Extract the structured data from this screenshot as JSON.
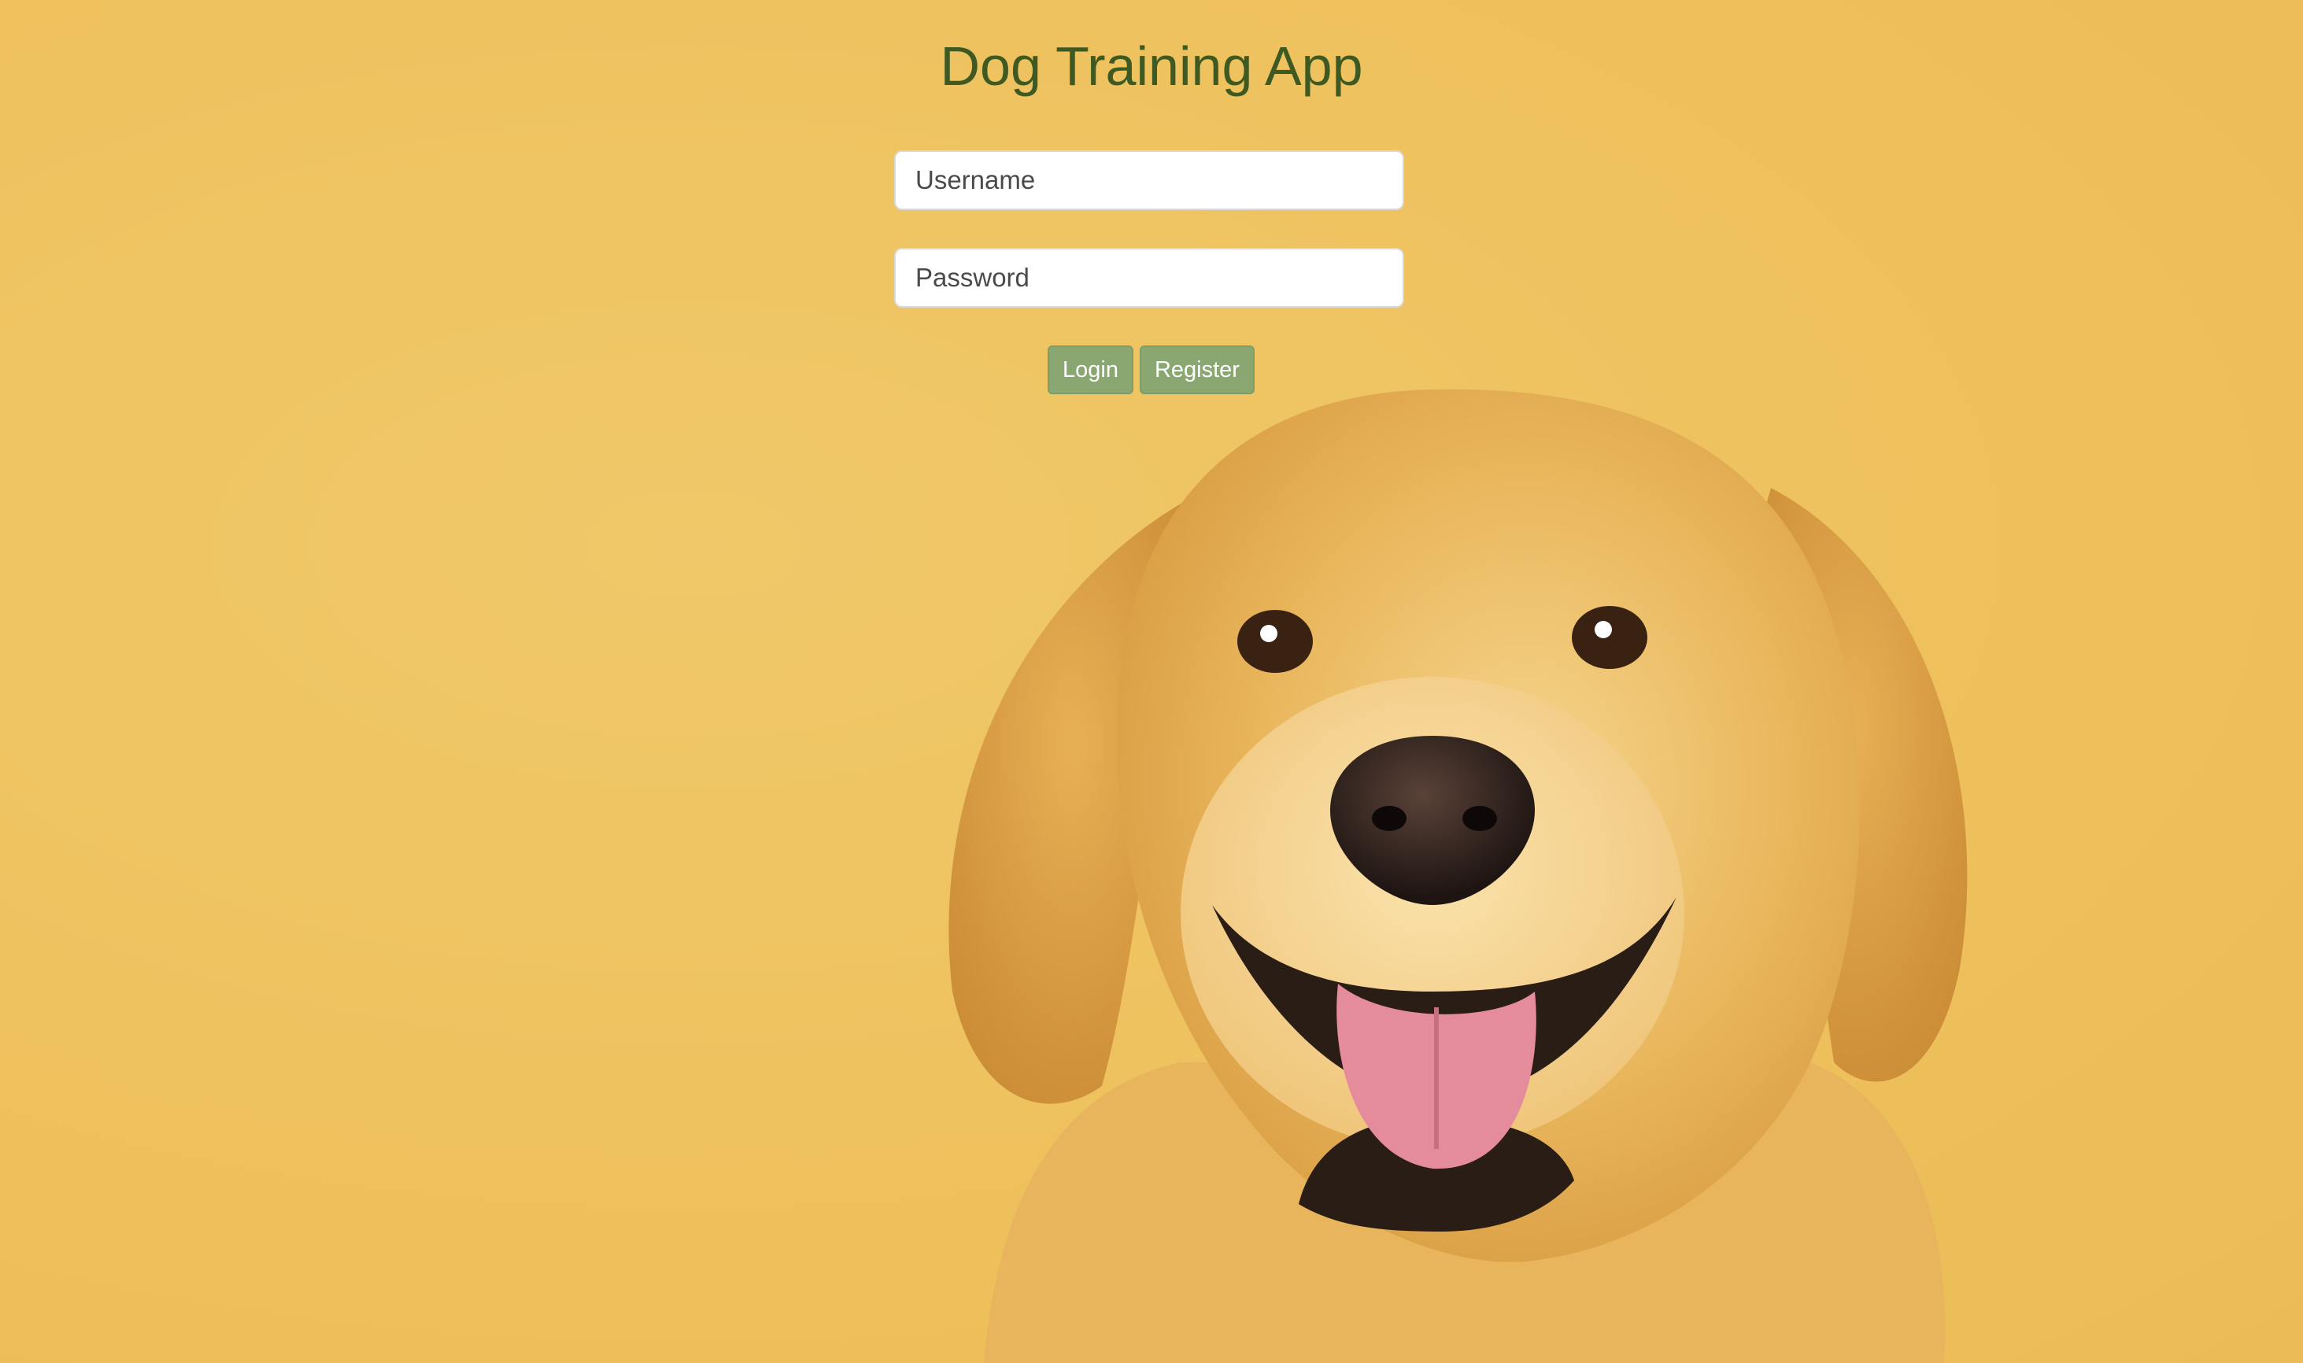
{
  "app": {
    "title": "Dog Training App"
  },
  "login_form": {
    "username_placeholder": "Username",
    "password_placeholder": "Password",
    "login_label": "Login",
    "register_label": "Register"
  },
  "theme": {
    "background": "#efc35f",
    "title_color": "#3e5a22",
    "button_color": "#8aa772"
  },
  "background_image": {
    "subject": "golden retriever portrait"
  }
}
